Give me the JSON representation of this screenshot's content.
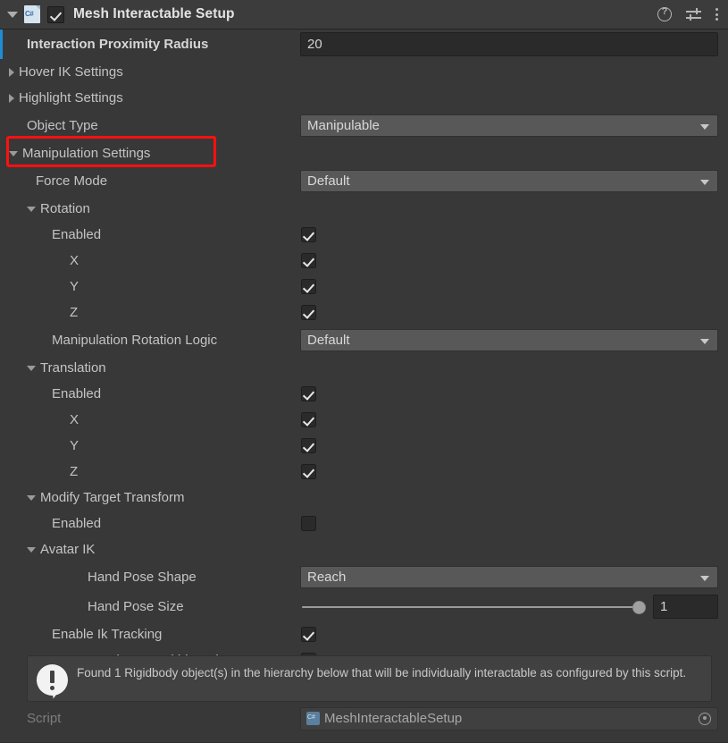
{
  "header": {
    "title": "Mesh Interactable Setup",
    "script_icon": "csharp-script-icon",
    "enabled_checkbox": true,
    "help_icon": "help-icon",
    "preset_icon": "preset-settings-icon",
    "menu_icon": "more-options-icon"
  },
  "fields": {
    "proximity": {
      "label": "Interaction Proximity Radius",
      "value": "20"
    },
    "hover_ik": {
      "label": "Hover IK Settings"
    },
    "highlight": {
      "label": "Highlight Settings"
    },
    "object_type": {
      "label": "Object Type",
      "value": "Manipulable"
    },
    "manipulation": {
      "label": "Manipulation Settings"
    },
    "force_mode": {
      "label": "Force Mode",
      "value": "Default"
    },
    "rotation": {
      "label": "Rotation"
    },
    "rotation_enabled": {
      "label": "Enabled",
      "value": true
    },
    "rotation_x": {
      "label": "X",
      "value": true
    },
    "rotation_y": {
      "label": "Y",
      "value": true
    },
    "rotation_z": {
      "label": "Z",
      "value": true
    },
    "rotation_logic": {
      "label": "Manipulation Rotation Logic",
      "value": "Default"
    },
    "translation": {
      "label": "Translation"
    },
    "translation_enabled": {
      "label": "Enabled",
      "value": true
    },
    "translation_x": {
      "label": "X",
      "value": true
    },
    "translation_y": {
      "label": "Y",
      "value": true
    },
    "translation_z": {
      "label": "Z",
      "value": true
    },
    "modify_target": {
      "label": "Modify Target Transform"
    },
    "modify_target_enabled": {
      "label": "Enabled",
      "value": false
    },
    "avatar_ik": {
      "label": "Avatar IK"
    },
    "hand_pose_shape": {
      "label": "Hand Pose Shape",
      "value": "Reach"
    },
    "hand_pose_size": {
      "label": "Hand Pose Size",
      "value": "1"
    },
    "enable_ik_tracking": {
      "label": "Enable Ik Tracking",
      "value": true
    },
    "constrain_arm": {
      "label": "Constrain Arm Within Sphere",
      "value": true
    }
  },
  "helpbox": {
    "icon": "info-exclamation-icon",
    "text": "Found 1 Rigidbody object(s) in the hierarchy below that will be individually interactable as configured by this script."
  },
  "script_row": {
    "label": "Script",
    "value": "MeshInteractableSetup",
    "picker_icon": "object-picker-icon"
  },
  "annotation": {
    "highlight_color": "#ff1010",
    "target": "Manipulation Settings"
  },
  "colors": {
    "panel_bg": "#383838",
    "header_bg": "#3c3c3c",
    "field_bg": "#2a2a2a",
    "dropdown_bg": "#585858",
    "override_bar": "#1f8bd4"
  }
}
